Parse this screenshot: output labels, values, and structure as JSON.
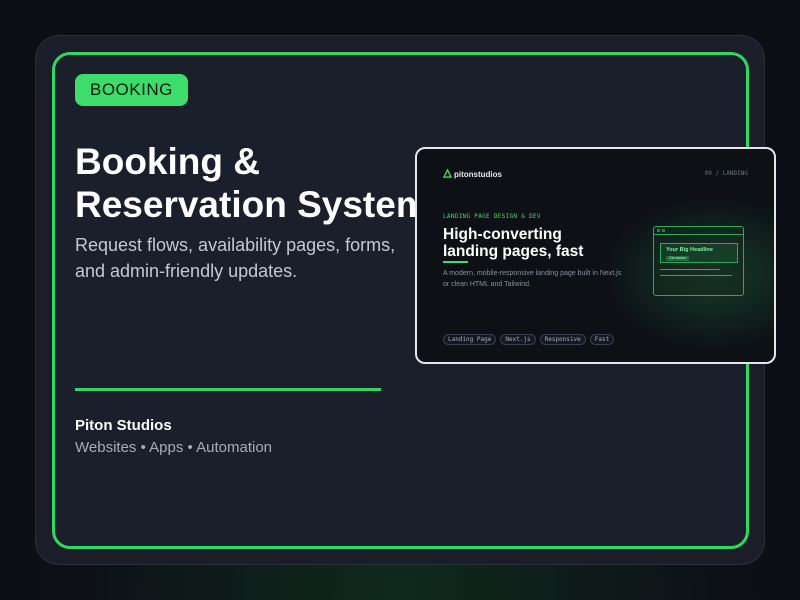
{
  "badge": "BOOKING",
  "title_line1": "Booking &",
  "title_line2": "Reservation System",
  "subtitle": "Request flows, availability pages, forms, and admin-friendly updates.",
  "company": "Piton Studios",
  "services": "Websites • Apps • Automation",
  "colors": {
    "accent": "#2fd864",
    "card_bg": "#1b1e2b",
    "page_bg": "#0d1117"
  },
  "preview": {
    "logo_text": "pitonstudios",
    "logo_icon": "triangle-logo-icon",
    "crumb": "09 / LANDING",
    "kicker": "LANDING PAGE DESIGN & DEV",
    "headline_line1": "High-converting",
    "headline_line2": "landing pages, fast",
    "description": "A modern, mobile-responsive landing page built in Next.js or clean HTML and Tailwind.",
    "tags": [
      "Landing Page",
      "Next.js",
      "Responsive",
      "Fast"
    ],
    "mock": {
      "headline": "Your Big Headline",
      "button": "Get started"
    }
  }
}
